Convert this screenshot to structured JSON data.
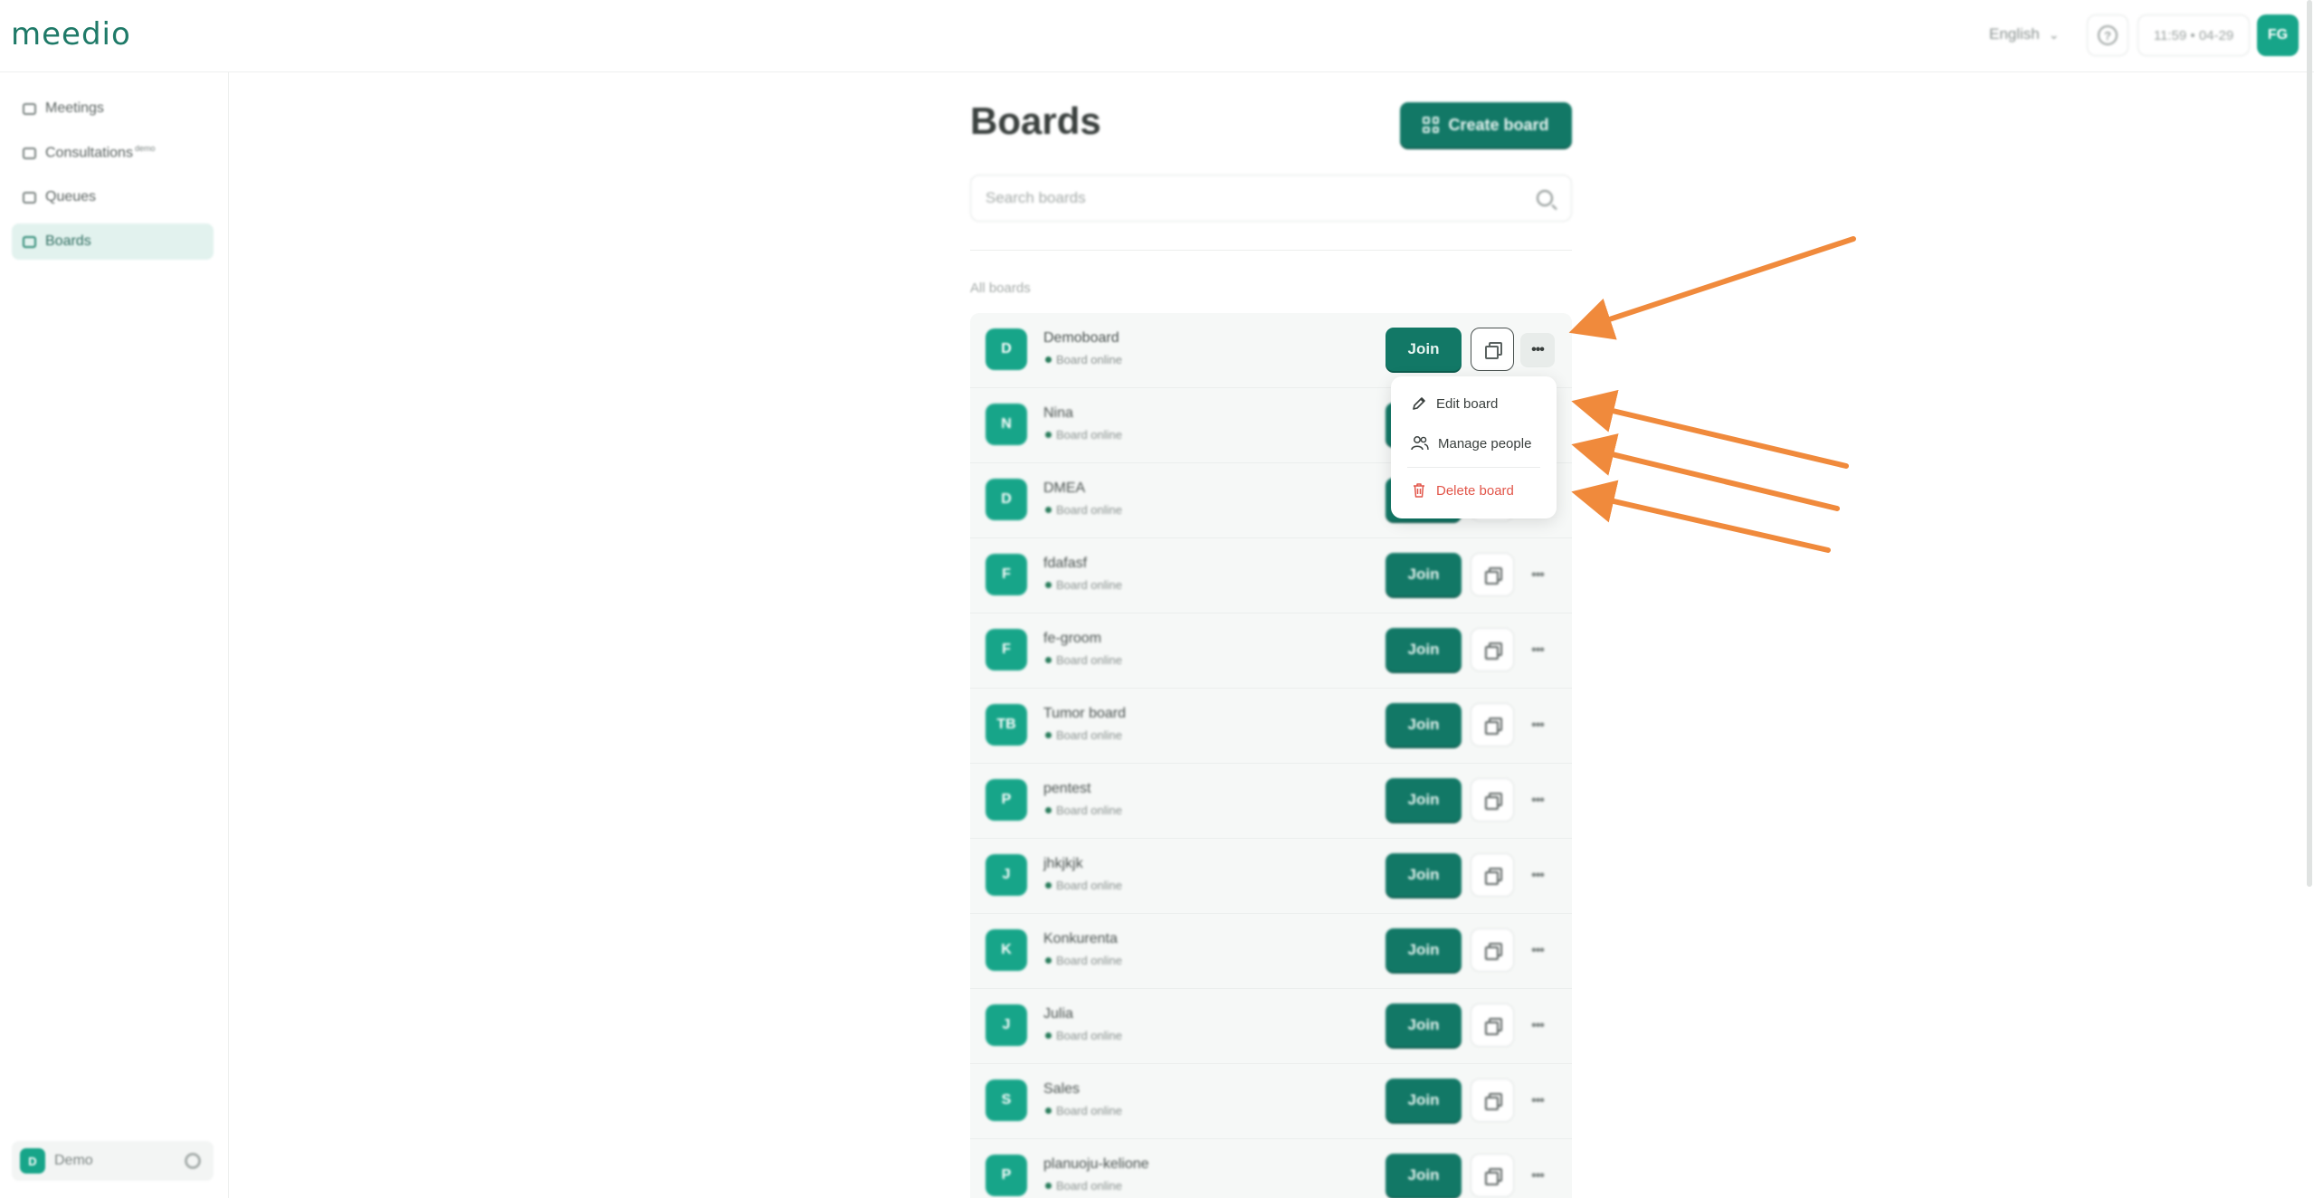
{
  "app": {
    "logo": "meedio"
  },
  "topbar": {
    "language": "English",
    "time": "11:59 • 04-29",
    "user_initials": "FG"
  },
  "sidebar": {
    "items": [
      {
        "label": "Meetings",
        "badge": ""
      },
      {
        "label": "Consultations",
        "badge": "demo"
      },
      {
        "label": "Queues",
        "badge": ""
      },
      {
        "label": "Boards",
        "badge": ""
      }
    ],
    "org": {
      "initial": "D",
      "name": "Demo"
    }
  },
  "main": {
    "title": "Boards",
    "create_label": "Create board",
    "search_placeholder": "Search boards",
    "section_label": "All boards",
    "join_label": "Join",
    "boards": [
      {
        "initials": "D",
        "name": "Demoboard",
        "status": "Board online"
      },
      {
        "initials": "N",
        "name": "Nina",
        "status": "Board online"
      },
      {
        "initials": "D",
        "name": "DMEA",
        "status": "Board online"
      },
      {
        "initials": "F",
        "name": "fdafasf",
        "status": "Board online"
      },
      {
        "initials": "F",
        "name": "fe-groom",
        "status": "Board online"
      },
      {
        "initials": "TB",
        "name": "Tumor board",
        "status": "Board online"
      },
      {
        "initials": "P",
        "name": "pentest",
        "status": "Board online"
      },
      {
        "initials": "J",
        "name": "jhkjkjk",
        "status": "Board online"
      },
      {
        "initials": "K",
        "name": "Konkurenta",
        "status": "Board online"
      },
      {
        "initials": "J",
        "name": "Julia",
        "status": "Board online"
      },
      {
        "initials": "S",
        "name": "Sales",
        "status": "Board online"
      },
      {
        "initials": "P",
        "name": "planuoju-kelione",
        "status": "Board online"
      }
    ]
  },
  "menu": {
    "edit": "Edit board",
    "manage": "Manage people",
    "delete": "Delete board"
  },
  "colors": {
    "brand": "#127866",
    "accent": "#17a589",
    "danger": "#e2564a",
    "annotation": "#f08a3c"
  }
}
